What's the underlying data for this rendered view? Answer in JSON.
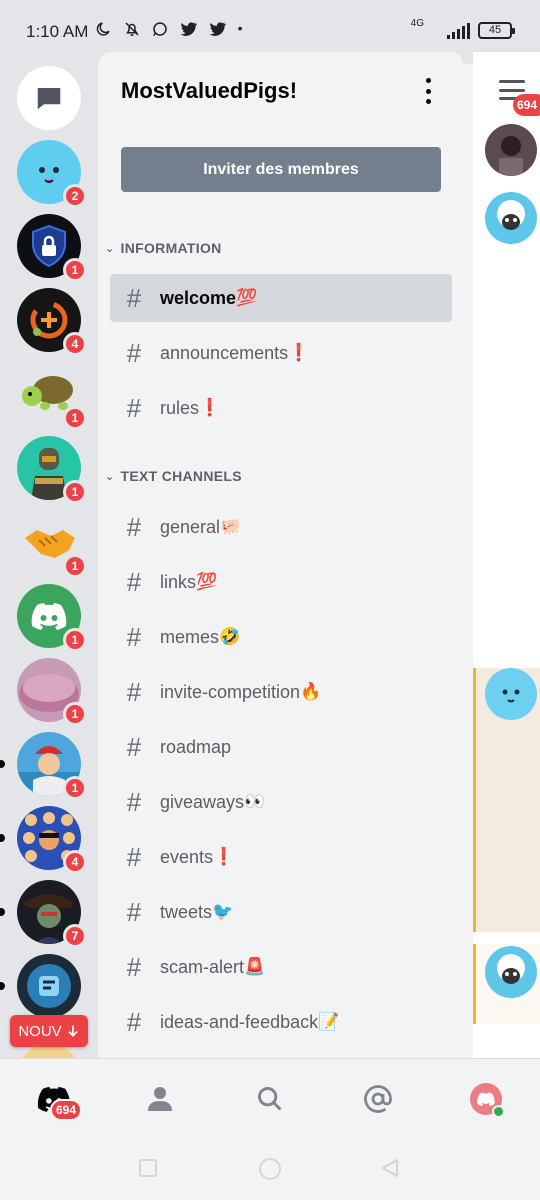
{
  "status_bar": {
    "time": "1:10 AM",
    "network": "4G",
    "battery": "45"
  },
  "rail": {
    "servers": [
      {
        "name": "direct-messages",
        "badge": ""
      },
      {
        "name": "server-blue-face",
        "badge": "2"
      },
      {
        "name": "server-shield-lock",
        "badge": "1"
      },
      {
        "name": "server-orange-cross",
        "badge": "4"
      },
      {
        "name": "server-turtle",
        "badge": "1"
      },
      {
        "name": "server-soldier",
        "badge": "1"
      },
      {
        "name": "server-handshake",
        "badge": "1"
      },
      {
        "name": "server-discord",
        "badge": "1"
      },
      {
        "name": "server-donut",
        "badge": "1"
      },
      {
        "name": "server-santa",
        "badge": "1"
      },
      {
        "name": "server-pattern",
        "badge": "4"
      },
      {
        "name": "server-pirate",
        "badge": "7"
      },
      {
        "name": "server-blue-robot",
        "badge": ""
      }
    ],
    "new_label": "NOUV"
  },
  "panel": {
    "server_name": "MostValuedPigs!",
    "invite_label": "Inviter des membres",
    "categories": [
      {
        "label": "INFORMATION",
        "channels": [
          {
            "name": "welcome",
            "emoji": "💯",
            "selected": true
          },
          {
            "name": "announcements",
            "emoji": "❗"
          },
          {
            "name": "rules",
            "emoji": "❗"
          }
        ]
      },
      {
        "label": "TEXT CHANNELS",
        "channels": [
          {
            "name": "general",
            "emoji": "🐖"
          },
          {
            "name": "links",
            "emoji": "💯"
          },
          {
            "name": "memes",
            "emoji": "🤣"
          },
          {
            "name": "invite-competition",
            "emoji": "🔥"
          },
          {
            "name": "roadmap",
            "emoji": ""
          },
          {
            "name": "giveaways",
            "emoji": "👀"
          },
          {
            "name": "events",
            "emoji": "❗"
          },
          {
            "name": "tweets",
            "emoji": "🐦"
          },
          {
            "name": "scam-alert",
            "emoji": "🚨"
          },
          {
            "name": "ideas-and-feedback",
            "emoji": "📝"
          }
        ]
      }
    ]
  },
  "peek": {
    "badge": "694"
  },
  "bottom_nav": {
    "home_badge": "694",
    "items": [
      "home",
      "friends",
      "search",
      "mentions",
      "profile"
    ]
  },
  "colors": {
    "accent_red": "#ed4245",
    "blurple": "#5865f2",
    "invite_button": "#747f8d",
    "selected_channel": "#d4d7dc"
  }
}
